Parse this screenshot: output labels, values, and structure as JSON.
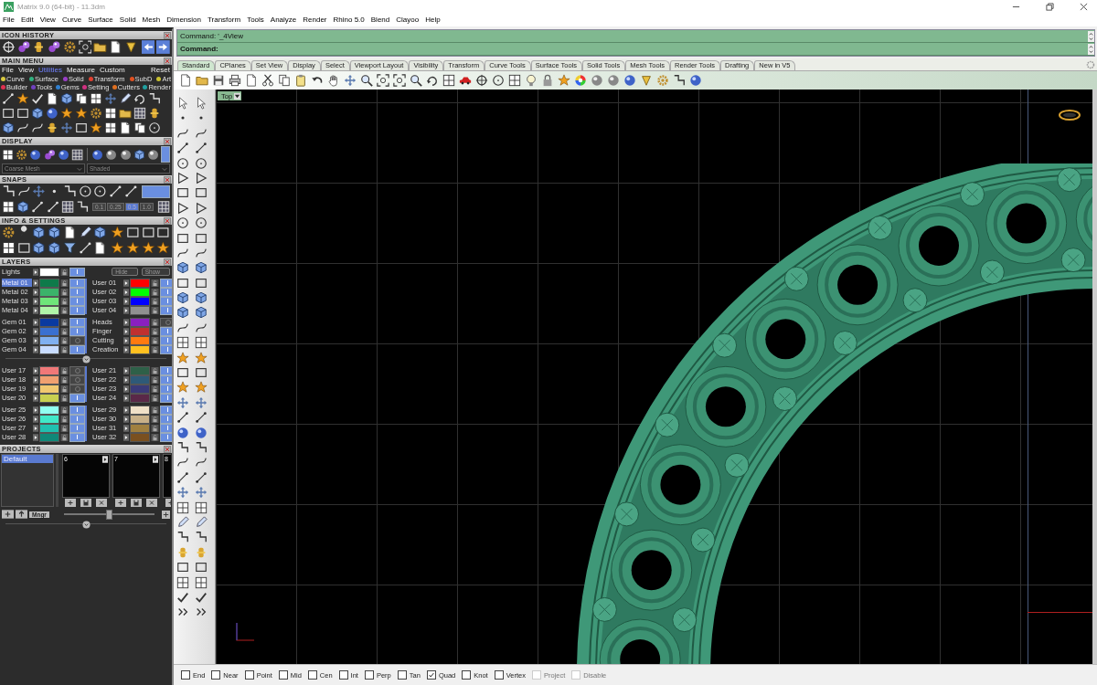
{
  "window": {
    "title": "Matrix 9.0 (64-bit) - 11.3dm"
  },
  "menu_bar": [
    "File",
    "Edit",
    "View",
    "Curve",
    "Surface",
    "Solid",
    "Mesh",
    "Dimension",
    "Transform",
    "Tools",
    "Analyze",
    "Render",
    "Rhino 5.0",
    "Blend",
    "Clayoo",
    "Help"
  ],
  "icon_history": {
    "title": "ICON HISTORY"
  },
  "main_menu": {
    "title": "MAIN MENU",
    "tabs": [
      {
        "label": "File",
        "selected": false
      },
      {
        "label": "View",
        "selected": false
      },
      {
        "label": "Utilities",
        "selected": true
      },
      {
        "label": "Measure",
        "selected": false
      },
      {
        "label": "Custom",
        "selected": false
      }
    ],
    "reset": "Reset",
    "categories": [
      [
        {
          "label": "Curve",
          "color": "#d8c840"
        },
        {
          "label": "Surface",
          "color": "#30b080"
        },
        {
          "label": "Solid",
          "color": "#9a40c8"
        },
        {
          "label": "Transform",
          "color": "#e04030"
        },
        {
          "label": "SubD",
          "color": "#e05020"
        },
        {
          "label": "Art",
          "color": "#c8c030"
        }
      ],
      [
        {
          "label": "Builder",
          "color": "#e03050"
        },
        {
          "label": "Tools",
          "color": "#7040c0"
        },
        {
          "label": "Gems",
          "color": "#3080d0"
        },
        {
          "label": "Setting",
          "color": "#d03080"
        },
        {
          "label": "Cutters",
          "color": "#e07020"
        },
        {
          "label": "Render",
          "color": "#20a0a0"
        }
      ]
    ]
  },
  "display": {
    "title": "DISPLAY",
    "mesh_dropdown": "Coarse Mesh",
    "shading_dropdown": "Shaded"
  },
  "snaps": {
    "title": "SNAPS",
    "grid_values": [
      {
        "label": "0.1",
        "selected": false
      },
      {
        "label": "0.25",
        "selected": false
      },
      {
        "label": "0.5",
        "selected": true
      },
      {
        "label": "1.0",
        "selected": false
      }
    ]
  },
  "info_settings": {
    "title": "INFO & SETTINGS"
  },
  "layers": {
    "title": "LAYERS",
    "lights": {
      "name": "Lights",
      "color": "#ffffff",
      "visible": true
    },
    "hide_button": "Hide",
    "show_button": "Show",
    "blocks": [
      {
        "left": [
          {
            "name": "Metal 01",
            "color": "#0e7a4a",
            "visible": true,
            "selected": true
          },
          {
            "name": "Metal 02",
            "color": "#3bb36a",
            "visible": true,
            "selected": false
          },
          {
            "name": "Metal 03",
            "color": "#6fe67a",
            "visible": true,
            "selected": false
          },
          {
            "name": "Metal 04",
            "color": "#b0f5a8",
            "visible": true,
            "selected": false
          }
        ],
        "right": [
          {
            "name": "User 01",
            "color": "#ff0000",
            "visible": true,
            "selected": false
          },
          {
            "name": "User 02",
            "color": "#00ff00",
            "visible": true,
            "selected": false
          },
          {
            "name": "User 03",
            "color": "#0000ff",
            "visible": true,
            "selected": false
          },
          {
            "name": "User 04",
            "color": "#909090",
            "visible": true,
            "selected": false
          }
        ]
      },
      {
        "left": [
          {
            "name": "Gem 01",
            "color": "#0a3aa0",
            "visible": true,
            "selected": false
          },
          {
            "name": "Gem 02",
            "color": "#3a70d0",
            "visible": true,
            "selected": false
          },
          {
            "name": "Gem 03",
            "color": "#80b0f0",
            "visible": false,
            "selected": false
          },
          {
            "name": "Gem 04",
            "color": "#c8dcff",
            "visible": true,
            "selected": false
          }
        ],
        "right": [
          {
            "name": "Heads",
            "color": "#8a20c0",
            "visible": false,
            "selected": false
          },
          {
            "name": "Finger",
            "color": "#c03030",
            "visible": true,
            "selected": false
          },
          {
            "name": "Cutting",
            "color": "#ff7a10",
            "visible": true,
            "selected": false
          },
          {
            "name": "Creation",
            "color": "#ffc020",
            "visible": true,
            "selected": false
          }
        ]
      },
      {
        "left": [
          {
            "name": "User 17",
            "color": "#f07878",
            "visible": false,
            "selected": false
          },
          {
            "name": "User 18",
            "color": "#f0a070",
            "visible": false,
            "selected": false
          },
          {
            "name": "User 19",
            "color": "#f0c870",
            "visible": false,
            "selected": false
          },
          {
            "name": "User 20",
            "color": "#c8d050",
            "visible": true,
            "selected": false
          }
        ],
        "right": [
          {
            "name": "User 21",
            "color": "#2e6048",
            "visible": true,
            "selected": false
          },
          {
            "name": "User 22",
            "color": "#2e5a78",
            "visible": true,
            "selected": false
          },
          {
            "name": "User 23",
            "color": "#3a3a78",
            "visible": true,
            "selected": false
          },
          {
            "name": "User 24",
            "color": "#5a2848",
            "visible": true,
            "selected": false
          }
        ]
      },
      {
        "left": [
          {
            "name": "User 25",
            "color": "#90fff0",
            "visible": true,
            "selected": false
          },
          {
            "name": "User 26",
            "color": "#40e8c8",
            "visible": true,
            "selected": false
          },
          {
            "name": "User 27",
            "color": "#20c0b0",
            "visible": true,
            "selected": false
          },
          {
            "name": "User 28",
            "color": "#108878",
            "visible": true,
            "selected": false
          }
        ],
        "right": [
          {
            "name": "User 29",
            "color": "#f0e0c8",
            "visible": true,
            "selected": false
          },
          {
            "name": "User 30",
            "color": "#c8b088",
            "visible": true,
            "selected": false
          },
          {
            "name": "User 31",
            "color": "#a08040",
            "visible": true,
            "selected": false
          },
          {
            "name": "User 32",
            "color": "#7a5020",
            "visible": true,
            "selected": false
          }
        ]
      }
    ]
  },
  "projects": {
    "title": "PROJECTS",
    "list": [
      {
        "label": "Default",
        "selected": true
      }
    ],
    "thumbnails": [
      {
        "label": "6"
      },
      {
        "label": "7"
      },
      {
        "label": "8"
      }
    ],
    "manager_button": "Mngr",
    "thumbnail_slider": {
      "level": 0.5
    }
  },
  "command": {
    "history": "Command: '_4View",
    "prompt": "Command:"
  },
  "toolbar_tabs": [
    {
      "label": "Standard",
      "selected": true
    },
    {
      "label": "CPlanes",
      "selected": false
    },
    {
      "label": "Set View",
      "selected": false
    },
    {
      "label": "Display",
      "selected": false
    },
    {
      "label": "Select",
      "selected": false
    },
    {
      "label": "Viewport Layout",
      "selected": false
    },
    {
      "label": "Visibility",
      "selected": false
    },
    {
      "label": "Transform",
      "selected": false
    },
    {
      "label": "Curve Tools",
      "selected": false
    },
    {
      "label": "Surface Tools",
      "selected": false
    },
    {
      "label": "Solid Tools",
      "selected": false
    },
    {
      "label": "Mesh Tools",
      "selected": false
    },
    {
      "label": "Render Tools",
      "selected": false
    },
    {
      "label": "Drafting",
      "selected": false
    },
    {
      "label": "New in V5",
      "selected": false
    }
  ],
  "viewport": {
    "label": "Top"
  },
  "osnaps": [
    {
      "label": "End",
      "checked": false,
      "disabled": false
    },
    {
      "label": "Near",
      "checked": false,
      "disabled": false
    },
    {
      "label": "Point",
      "checked": false,
      "disabled": false
    },
    {
      "label": "Mid",
      "checked": false,
      "disabled": false
    },
    {
      "label": "Cen",
      "checked": false,
      "disabled": false
    },
    {
      "label": "Int",
      "checked": false,
      "disabled": false
    },
    {
      "label": "Perp",
      "checked": false,
      "disabled": false
    },
    {
      "label": "Tan",
      "checked": false,
      "disabled": false
    },
    {
      "label": "Quad",
      "checked": true,
      "disabled": false
    },
    {
      "label": "Knot",
      "checked": false,
      "disabled": false
    },
    {
      "label": "Vertex",
      "checked": false,
      "disabled": false
    },
    {
      "label": "Project",
      "checked": false,
      "disabled": true
    },
    {
      "label": "Disable",
      "checked": false,
      "disabled": true
    }
  ]
}
